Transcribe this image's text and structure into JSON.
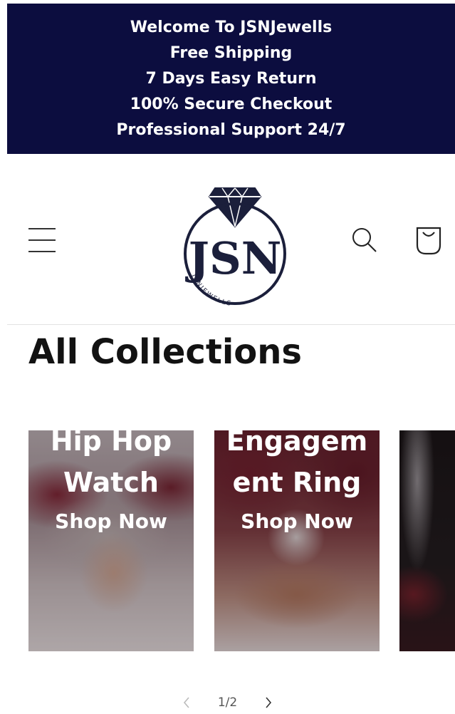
{
  "announcement": {
    "lines": [
      "Welcome To JSNJewells",
      "Free Shipping",
      "7 Days Easy Return",
      "100% Secure Checkout",
      "Professional Support 24/7"
    ],
    "background": "#0c0d3f"
  },
  "header": {
    "menu_icon": "hamburger-icon",
    "logo": {
      "monogram": "JSN",
      "arc_text": "JSNJEWELLS"
    },
    "search_icon": "search-icon",
    "cart_icon": "cart-icon"
  },
  "page": {
    "title": "All Collections"
  },
  "collections": [
    {
      "title": "Hip Hop Watch",
      "cta": "Shop Now"
    },
    {
      "title": "Engagement Ring",
      "cta": "Shop Now"
    },
    {
      "title": "",
      "cta": ""
    }
  ],
  "pagination": {
    "prev_icon": "chevron-left-icon",
    "next_icon": "chevron-right-icon",
    "current": "1/2"
  },
  "colors": {
    "brand_navy": "#0c0d3f",
    "text": "#121212"
  }
}
